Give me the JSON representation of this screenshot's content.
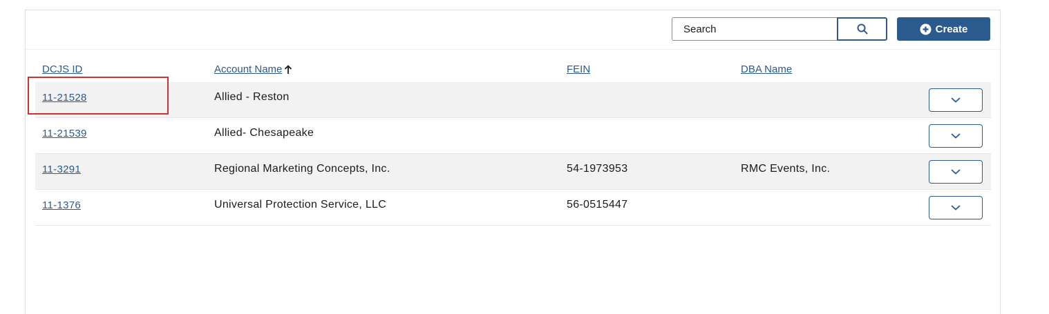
{
  "toolbar": {
    "search_placeholder": "Search",
    "search_value": "",
    "create_label": "Create"
  },
  "table": {
    "headers": {
      "dcjs_id": "DCJS ID",
      "account_name": "Account Name",
      "fein": "FEIN",
      "dba_name": "DBA Name"
    },
    "sort": {
      "column": "account_name",
      "direction": "ascending",
      "icon": "arrow-up-icon"
    },
    "rows": [
      {
        "dcjs_id": "11-21528",
        "account_name": "Allied - Reston",
        "fein": "",
        "dba_name": ""
      },
      {
        "dcjs_id": "11-21539",
        "account_name": "Allied- Chesapeake",
        "fein": "",
        "dba_name": ""
      },
      {
        "dcjs_id": "11-3291",
        "account_name": "Regional Marketing Concepts, Inc.",
        "fein": "54-1973953",
        "dba_name": "RMC Events, Inc."
      },
      {
        "dcjs_id": "11-1376",
        "account_name": "Universal Protection Service, LLC",
        "fein": "56-0515447",
        "dba_name": ""
      }
    ]
  },
  "annotation": {
    "highlighted_cell": "11-21528",
    "color": "#d0312d"
  },
  "colors": {
    "accent": "#2b5a8f",
    "row_shade": "#f2f2f2",
    "text": "#1b1b1b"
  }
}
